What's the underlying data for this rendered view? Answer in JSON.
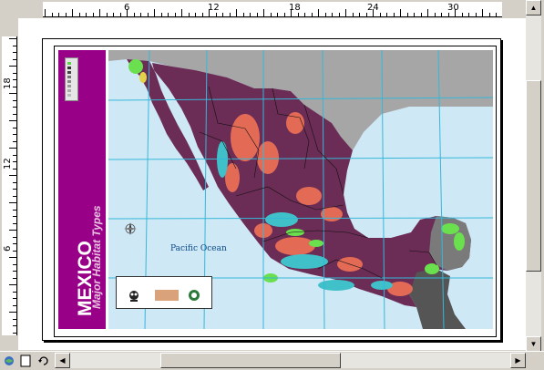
{
  "ruler": {
    "horizontal_labels": [
      "6",
      "12",
      "18",
      "24",
      "30"
    ],
    "vertical_labels": [
      "18",
      "12",
      "6"
    ]
  },
  "map": {
    "title": "MEXICO",
    "subtitle": "Major Habitat Types",
    "ocean_label": "Pacific Ocean",
    "colors": {
      "title_band": "#990088",
      "ocean": "#cfe8f6",
      "mexico": "#6b2c55",
      "usa": "#a6a6a6",
      "grid": "#35b8d8"
    }
  },
  "icons": {
    "scroll_up": "arrow-up-icon",
    "scroll_down": "arrow-down-icon",
    "scroll_left": "arrow-left-icon",
    "scroll_right": "arrow-right-icon"
  }
}
